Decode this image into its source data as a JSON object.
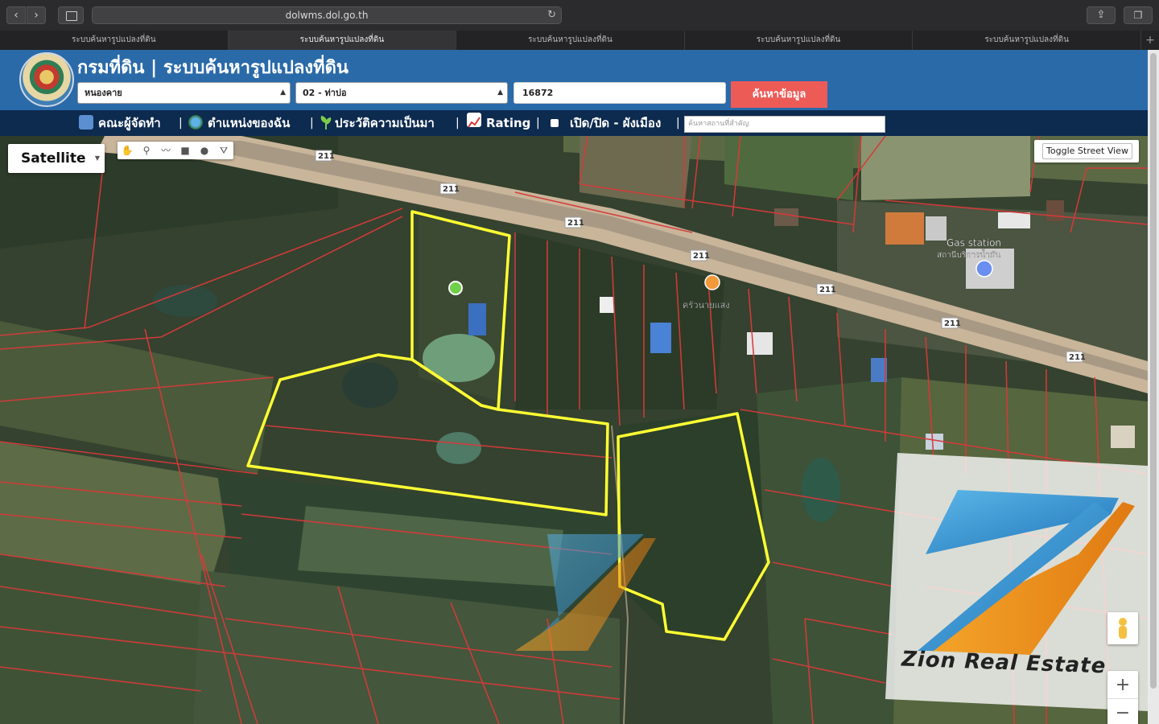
{
  "browser": {
    "url": "dolwms.dol.go.th",
    "tabs": [
      "ระบบค้นหารูปแปลงที่ดิน",
      "ระบบค้นหารูปแปลงที่ดิน",
      "ระบบค้นหารูปแปลงที่ดิน",
      "ระบบค้นหารูปแปลงที่ดิน",
      "ระบบค้นหารูปแปลงที่ดิน"
    ],
    "active_tab": 1
  },
  "header": {
    "title": "กรมที่ดิน | ระบบค้นหารูปแปลงที่ดิน",
    "province": "หนองคาย",
    "district": "02 - ท่าบ่อ",
    "parcel_number": "16872",
    "search_label": "ค้นหาข้อมูล"
  },
  "toolbar": {
    "organizers": "คณะผู้จัดทำ",
    "my_location": "ตำแหน่งของฉัน",
    "history": "ประวัติความเป็นมา",
    "rating": "Rating",
    "toggle_plan": "เปิด/ปิด - ผังเมือง",
    "place_search_placeholder": "ค้นหาสถานที่สำคัญ"
  },
  "map": {
    "map_type": "Satellite",
    "street_view_label": "Toggle Street View",
    "road_label": "211",
    "gas_station_label": "Gas station",
    "gas_station_sub": "สถานีบริการน้ำมัน",
    "shop_label": "ครัวนายแสง",
    "watermark": "Zion Real Estate",
    "zoom_in": "+",
    "zoom_out": "−",
    "colors": {
      "parcel_outline": "#ffff33",
      "cadastral_lines": "#d63a3a",
      "header": "#2a6aa9",
      "toolbar": "#0d2a4f",
      "search_button": "#ed5b57"
    }
  }
}
